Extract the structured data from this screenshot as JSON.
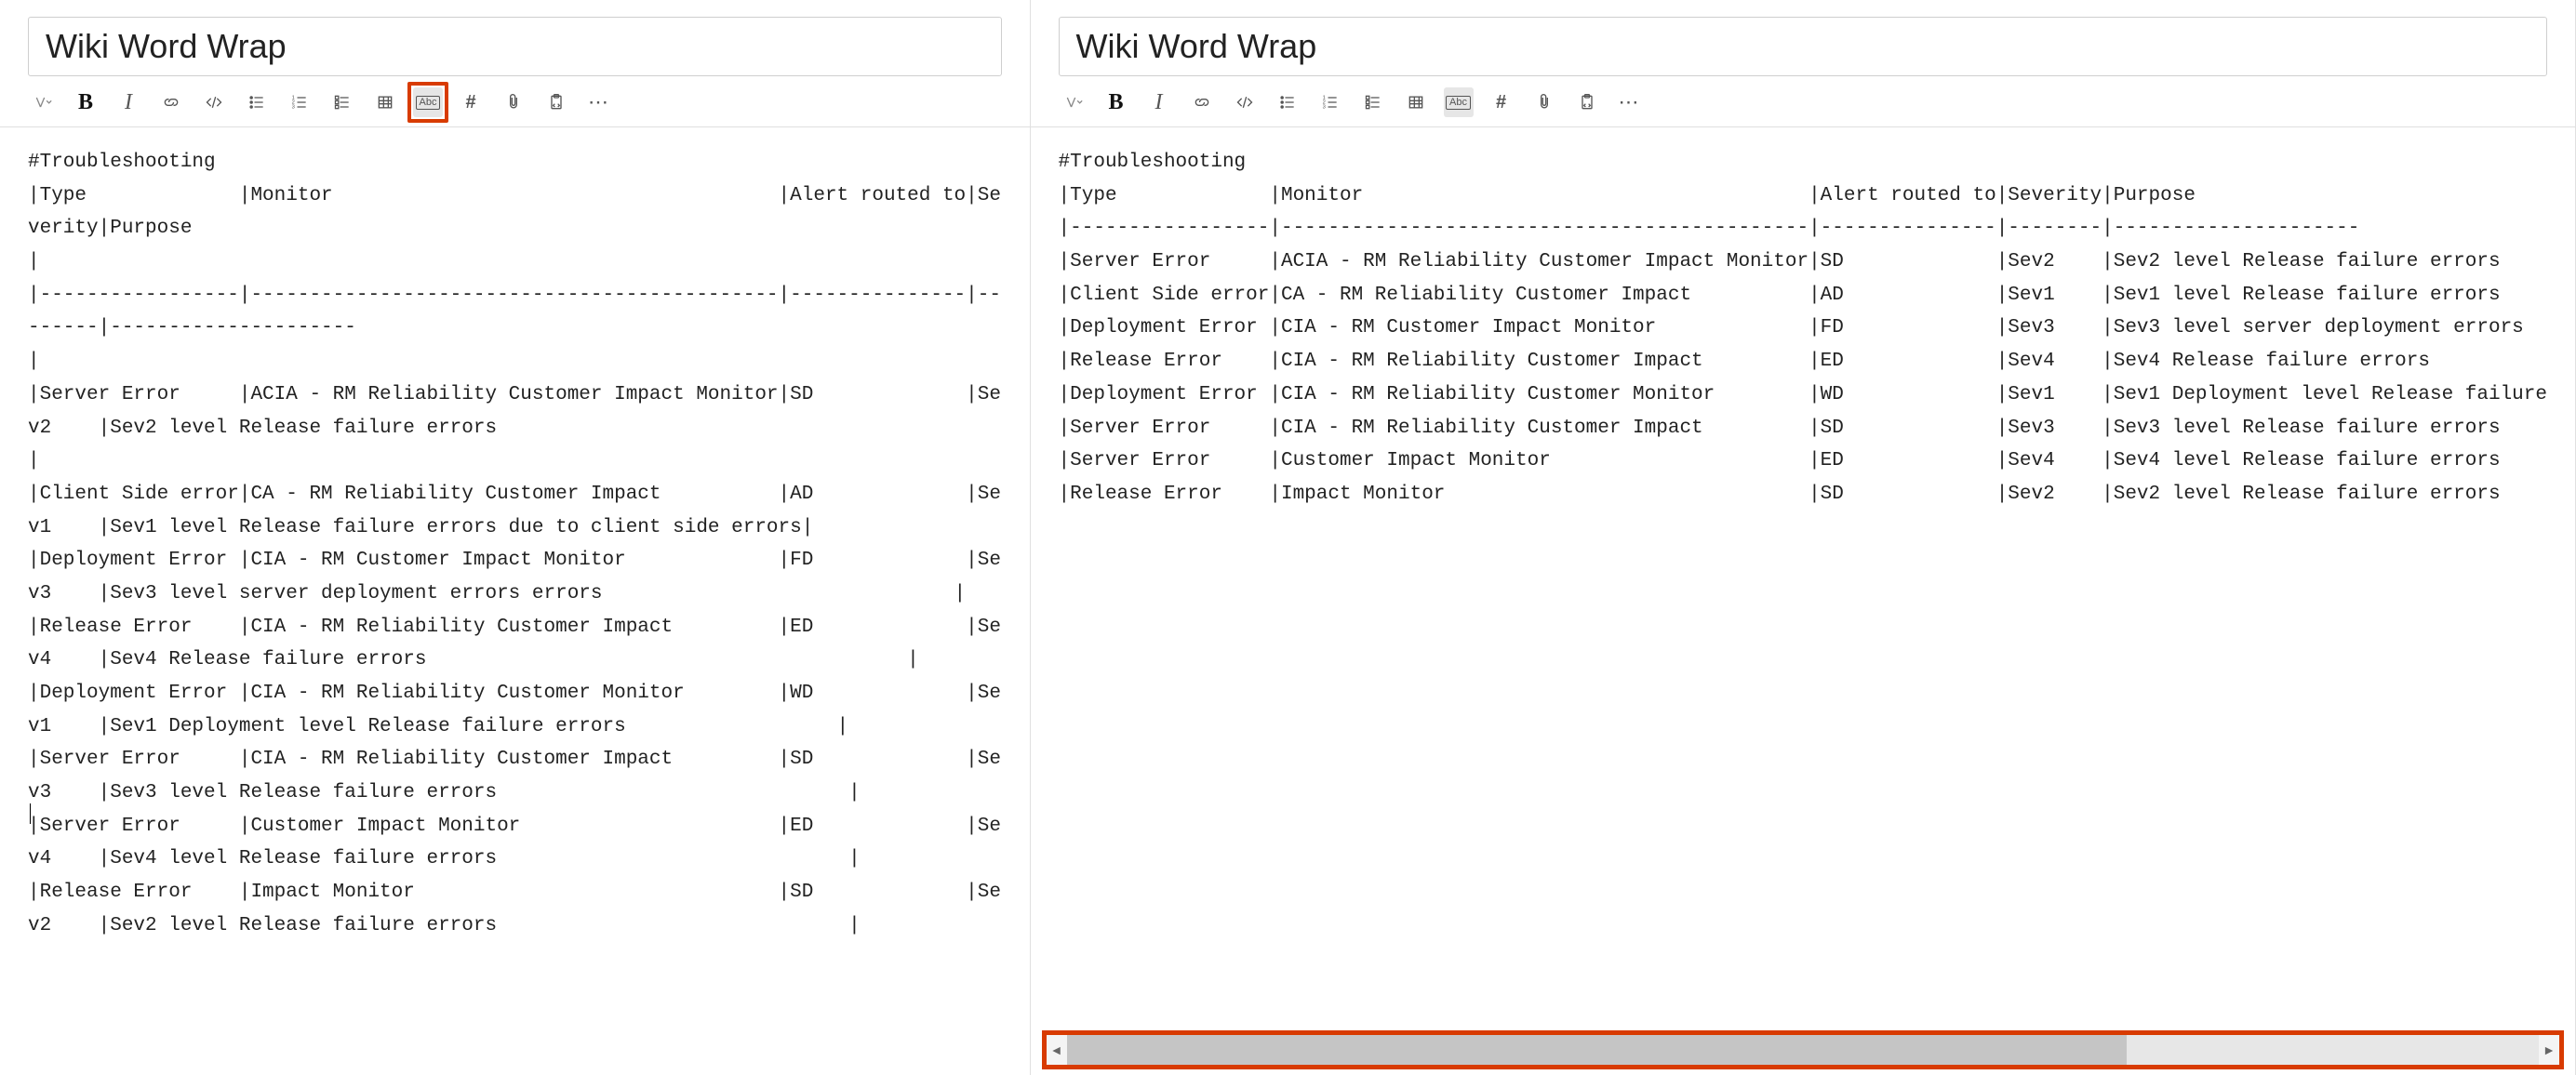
{
  "left": {
    "title": "Wiki Word Wrap",
    "wrap_active": true,
    "wrap_highlighted": true,
    "content": "#Troubleshooting\n|Type             |Monitor                                      |Alert routed to|Severity|Purpose\n|\n|-----------------|---------------------------------------------|---------------|--------|---------------------\n|\n|Server Error     |ACIA - RM Reliability Customer Impact Monitor|SD             |Sev2    |Sev2 level Release failure errors                                              |\n|Client Side error|CA - RM Reliability Customer Impact          |AD             |Sev1    |Sev1 level Release failure errors due to client side errors|\n|Deployment Error |CIA - RM Customer Impact Monitor             |FD             |Sev3    |Sev3 level server deployment errors errors                              |\n|Release Error    |CIA - RM Reliability Customer Impact         |ED             |Sev4    |Sev4 Release failure errors                                         |\n|Deployment Error |CIA - RM Reliability Customer Monitor        |WD             |Sev1    |Sev1 Deployment level Release failure errors                  |\n|Server Error     |CIA - RM Reliability Customer Impact         |SD             |Sev3    |Sev3 level Release failure errors                              |\n|Server Error     |Customer Impact Monitor                      |ED             |Sev4    |Sev4 level Release failure errors                              |\n|Release Error    |Impact Monitor                               |SD             |Sev2    |Sev2 level Release failure errors                              |\n\n"
  },
  "right": {
    "title": "Wiki Word Wrap",
    "wrap_active": true,
    "wrap_highlighted": false,
    "content": "#Troubleshooting\n|Type             |Monitor                                      |Alert routed to|Severity|Purpose\n|-----------------|---------------------------------------------|---------------|--------|---------------------\n|Server Error     |ACIA - RM Reliability Customer Impact Monitor|SD             |Sev2    |Sev2 level Release failure errors\n|Client Side error|CA - RM Reliability Customer Impact          |AD             |Sev1    |Sev1 level Release failure errors\n|Deployment Error |CIA - RM Customer Impact Monitor             |FD             |Sev3    |Sev3 level server deployment errors\n|Release Error    |CIA - RM Reliability Customer Impact         |ED             |Sev4    |Sev4 Release failure errors\n|Deployment Error |CIA - RM Reliability Customer Monitor        |WD             |Sev1    |Sev1 Deployment level Release failure\n|Server Error     |CIA - RM Reliability Customer Impact         |SD             |Sev3    |Sev3 level Release failure errors\n|Server Error     |Customer Impact Monitor                      |ED             |Sev4    |Sev4 level Release failure errors\n|Release Error    |Impact Monitor                               |SD             |Sev2    |Sev2 level Release failure errors"
  },
  "toolbar_labels": {
    "format": "Format",
    "bold": "B",
    "italic": "I",
    "hash": "#",
    "abc": "Abc",
    "more": "⋯"
  }
}
